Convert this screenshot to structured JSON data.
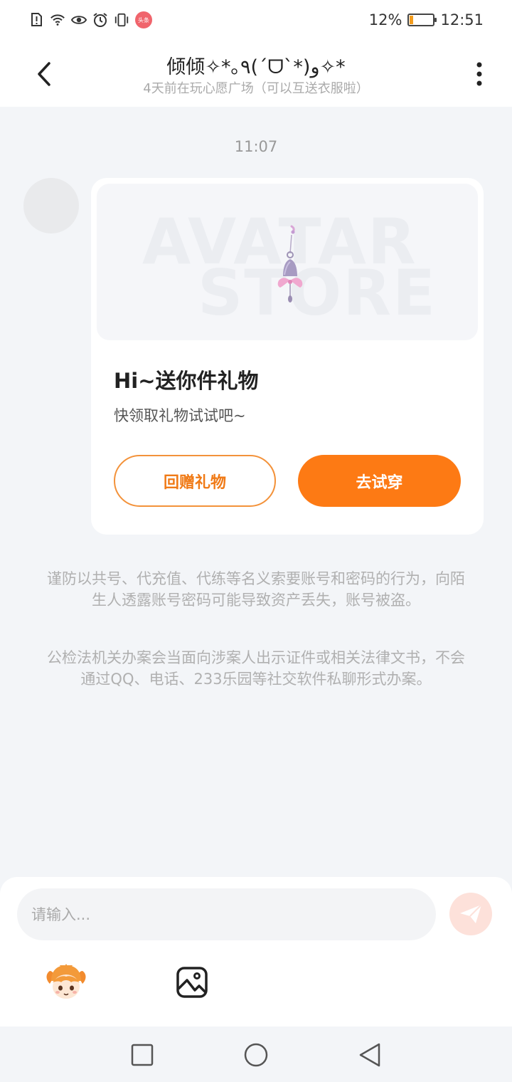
{
  "status_bar": {
    "battery_percent": "12%",
    "battery_level": 0.12,
    "time": "12:51",
    "badge_text": "头条",
    "icons": [
      "sim-alert-icon",
      "wifi-icon",
      "eye-icon",
      "alarm-icon",
      "vibrate-icon",
      "news-badge-icon"
    ]
  },
  "header": {
    "title": "倾倾✧*｡٩(ˊᗜˋ*)و✧*",
    "subtitle": "4天前在玩心愿广场（可以互送衣服啦）"
  },
  "chat": {
    "timestamp": "11:07",
    "gift_card": {
      "watermark_line1": "AVATAR",
      "watermark_line2": "STORE",
      "title": "Hi~送你件礼物",
      "description": "快领取礼物试试吧~",
      "return_gift_label": "回赠礼物",
      "try_on_label": "去试穿"
    },
    "notices": [
      "谨防以共号、代充值、代练等名义索要账号和密码的行为，向陌生人透露账号密码可能导致资产丢失，账号被盗。",
      "公检法机关办案会当面向涉案人出示证件或相关法律文书，不会通过QQ、电话、233乐园等社交软件私聊形式办案。"
    ]
  },
  "input": {
    "placeholder": "请输入..."
  },
  "colors": {
    "accent": "#fd7a14",
    "accent_border": "#f3923a",
    "background": "#f3f5f8",
    "send_button": "#fde1da"
  }
}
